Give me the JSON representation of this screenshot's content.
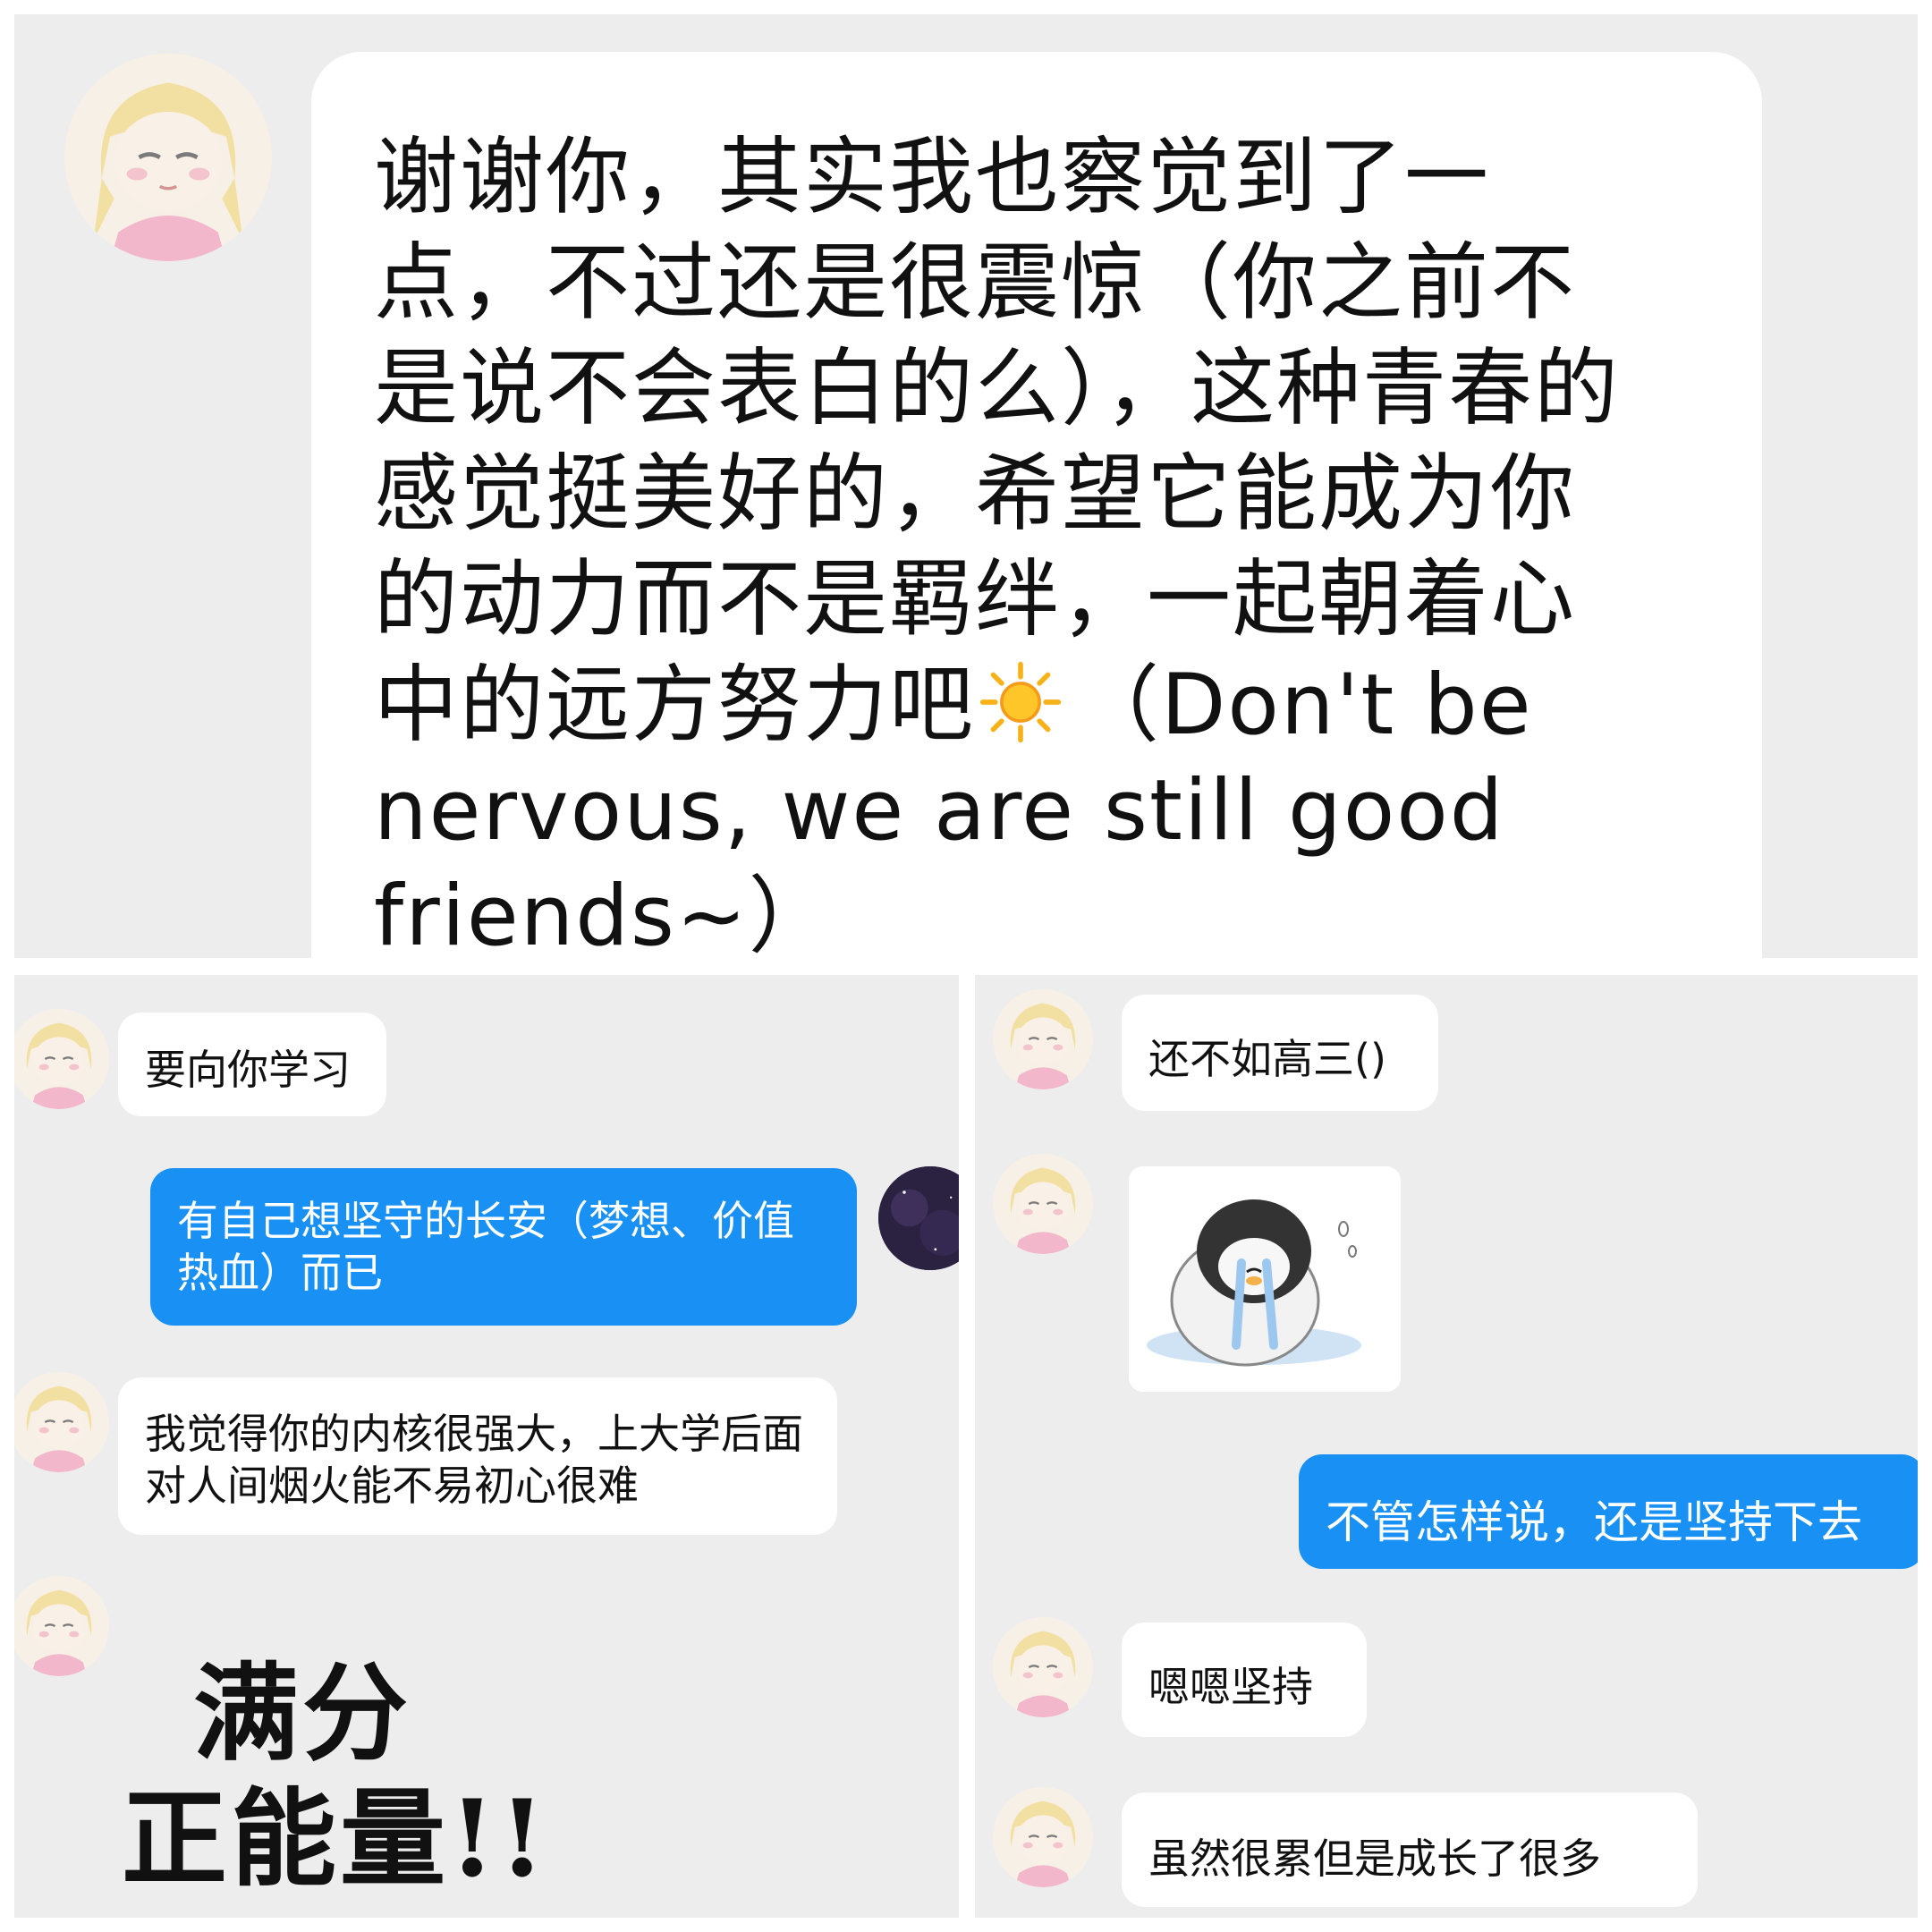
{
  "top_panel": {
    "message": "谢谢你，其实我也察觉到了一点，不过还是很震惊（你之前不是说不会表白的么），这种青春的感觉挺美好的，希望它能成为你的动力而不是羁绊，一起朝着心中的远方努力吧",
    "emoji": "sun-icon",
    "message_tail": "（Don't be nervous, we are still good friends~）"
  },
  "left_panel": {
    "messages": [
      {
        "sender": "other",
        "text": "要向你学习"
      },
      {
        "sender": "me",
        "text": "有自己想坚守的长安（梦想、价值热血）而已"
      },
      {
        "sender": "other",
        "text": "我觉得你的内核很强大，上大学后面对人间烟火能不易初心很难"
      }
    ],
    "sticker": {
      "line1": "满分",
      "line2": "正能量!!"
    }
  },
  "right_panel": {
    "messages": [
      {
        "sender": "other",
        "text": "还不如高三()"
      },
      {
        "sender": "other",
        "sticker": "crying-penguin-sticker"
      },
      {
        "sender": "me",
        "text": "不管怎样说，还是坚持下去"
      },
      {
        "sender": "other",
        "text": "嗯嗯坚持"
      },
      {
        "sender": "other",
        "text": "虽然很累但是成长了很多"
      }
    ]
  },
  "colors": {
    "panel_bg": "#ededed",
    "bubble_other": "#ffffff",
    "bubble_me": "#1890f4",
    "text": "#111111"
  }
}
